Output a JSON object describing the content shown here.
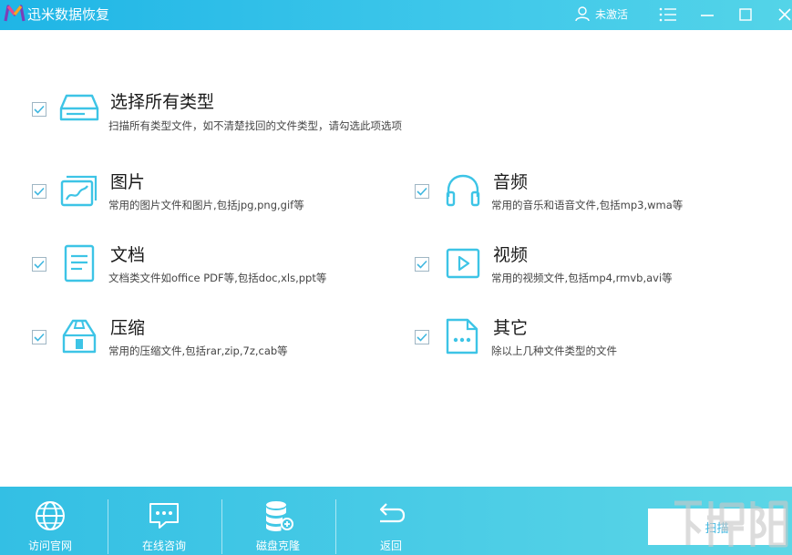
{
  "window": {
    "title": "迅米数据恢复",
    "user_label": "未激活",
    "accent": "#2fb9e3",
    "icon_color": "#3dc4e6"
  },
  "options": {
    "all": {
      "title": "选择所有类型",
      "desc": "扫描所有类型文件，如不清楚找回的文件类型，请勾选此项选项",
      "checked": true,
      "icon": "drive-icon"
    },
    "image": {
      "title": "图片",
      "desc": "常用的图片文件和图片,包括jpg,png,gif等",
      "checked": true,
      "icon": "picture-icon"
    },
    "audio": {
      "title": "音频",
      "desc": "常用的音乐和语音文件,包括mp3,wma等",
      "checked": true,
      "icon": "headphones-icon"
    },
    "document": {
      "title": "文档",
      "desc": "文档类文件如office PDF等,包括doc,xls,ppt等",
      "checked": true,
      "icon": "document-icon"
    },
    "video": {
      "title": "视频",
      "desc": "常用的视频文件,包括mp4,rmvb,avi等",
      "checked": true,
      "icon": "video-play-icon"
    },
    "archive": {
      "title": "压缩",
      "desc": "常用的压缩文件,包括rar,zip,7z,cab等",
      "checked": true,
      "icon": "archive-icon"
    },
    "other": {
      "title": "其它",
      "desc": "除以上几种文件类型的文件",
      "checked": true,
      "icon": "other-file-icon"
    }
  },
  "bottom": {
    "website": "访问官网",
    "chat": "在线咨询",
    "clone": "磁盘克隆",
    "back": "返回",
    "scan": "扫描"
  }
}
